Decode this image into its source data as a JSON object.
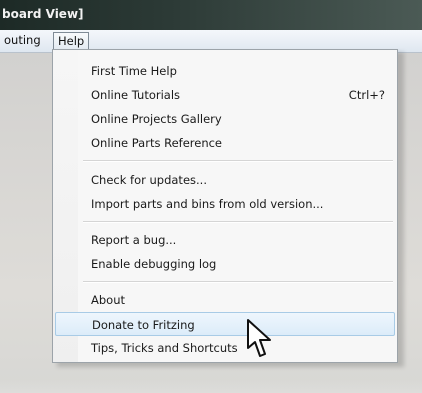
{
  "window": {
    "title": "board View]"
  },
  "menubar": {
    "items": [
      {
        "label": "outing"
      },
      {
        "label": "Help"
      }
    ]
  },
  "help_menu": {
    "items": [
      {
        "label": "First Time Help",
        "shortcut": ""
      },
      {
        "label": "Online Tutorials",
        "shortcut": "Ctrl+?"
      },
      {
        "label": "Online Projects Gallery",
        "shortcut": ""
      },
      {
        "label": "Online Parts Reference",
        "shortcut": ""
      },
      {
        "label": "Check for updates...",
        "shortcut": ""
      },
      {
        "label": "Import parts and bins from old version...",
        "shortcut": ""
      },
      {
        "label": "Report a bug...",
        "shortcut": ""
      },
      {
        "label": "Enable debugging log",
        "shortcut": ""
      },
      {
        "label": "About",
        "shortcut": ""
      },
      {
        "label": "Donate to Fritzing",
        "shortcut": ""
      },
      {
        "label": "Tips, Tricks and Shortcuts",
        "shortcut": ""
      }
    ]
  },
  "icons": {
    "cursor": "mouse-pointer-icon"
  },
  "colors": {
    "titlebar": "#1d2a26",
    "menubar": "#dfe7f0",
    "menu_background": "#f7f7f7",
    "highlight": "#dcecf9",
    "highlight_border": "#a8cbe6"
  }
}
